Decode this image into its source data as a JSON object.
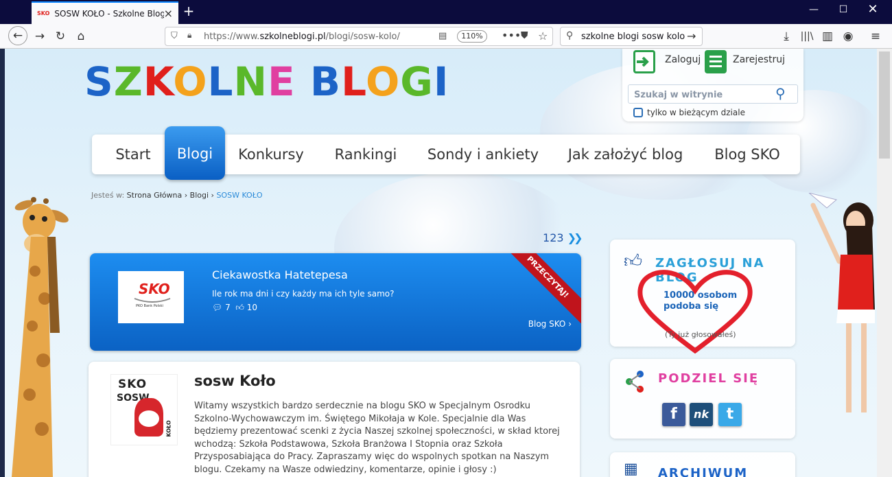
{
  "browser": {
    "tab_title": "SOSW KOŁO - Szkolne Blogi",
    "tab_favicon_text": "SKO",
    "url_prefix": "https://www.",
    "url_domain": "szkolneblogi.pl",
    "url_path": "/blogi/sosw-kolo/",
    "zoom": "110%",
    "search_query": "szkolne blogi sosw kolo",
    "icons": [
      "back-icon",
      "forward-icon",
      "reload-icon",
      "home-icon",
      "shield-icon",
      "lock-icon",
      "reader-icon",
      "more-icon",
      "pocket-icon",
      "star-icon",
      "search-icon",
      "download-icon",
      "library-icon",
      "sidebar-icon",
      "account-icon",
      "menu-icon"
    ]
  },
  "site": {
    "logo": "SZKOLNE BLOGI",
    "login_label": "Zaloguj",
    "register_label": "Zarejestruj",
    "search_placeholder": "Szukaj w witrynie",
    "search_scope_label": "tylko w bieżącym dziale"
  },
  "menu": [
    {
      "label": "Start"
    },
    {
      "label": "Blogi"
    },
    {
      "label": "Konkursy"
    },
    {
      "label": "Rankingi"
    },
    {
      "label": "Sondy i ankiety"
    },
    {
      "label": "Jak założyć blog"
    },
    {
      "label": "Blog SKO"
    }
  ],
  "breadcrumb": {
    "prefix": "Jesteś w:",
    "items": [
      "Strona Główna",
      "Blogi",
      "SOSW KOŁO"
    ]
  },
  "pagination": {
    "pages": [
      "1",
      "2",
      "3"
    ],
    "next": "»"
  },
  "featured": {
    "ribbon": "PRZECZYTAJ!",
    "image_text": "SKO",
    "image_sub": "PKO Bank Polski",
    "title": "Ciekawostka Hatetepesa",
    "description": "Ile rok ma dni i czy każdy ma ich tyle samo?",
    "comments": "7",
    "likes": "10",
    "link": "Blog SKO"
  },
  "blog": {
    "image_text": "SKO",
    "image_side": "SOSW",
    "image_kolo": "KOŁO",
    "title": "sosw Koło",
    "description": "Witamy wszystkich bardzo serdecznie na blogu SKO w Specjalnym Osrodku Szkolno-Wychowawczym im. Świętego Mikołaja w Kole. Specjalnie dla Was będziemy prezentować scenki z życia Naszej szkolnej społeczności, w skład ktorej wchodzą: Szkoła Podstawowa, Szkoła Branżowa I Stopnia oraz Szkoła Przysposabiająca do Pracy. Zapraszamy więc do wspolnych spotkan na Naszym blogu. Czekamy na Wasze odwiedziny, komentarze, opinie i głosy :)"
  },
  "sidebar": {
    "vote_title": "ZAGŁOSUJ NA BLOG",
    "vote_count_line1": "10000 osobom",
    "vote_count_line2": "podoba się",
    "vote_note": "(Ty już głosowałeś)",
    "share_title": "PODZIEL SIĘ",
    "share_buttons": [
      "f",
      "nk",
      "t"
    ],
    "archive_title": "ARCHIWUM"
  },
  "colors": {
    "accent": "#0a6fd6",
    "ribbon": "#c0141c",
    "heart": "#e3202c",
    "tabbar": "#0c0c3d"
  }
}
